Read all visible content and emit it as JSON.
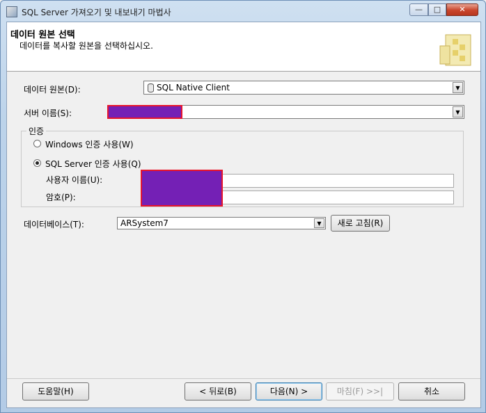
{
  "window": {
    "title": "SQL Server 가져오기 및 내보내기 마법사",
    "controls": {
      "minimize": "—",
      "maximize": "□",
      "close": "✕"
    }
  },
  "header": {
    "title": "데이터 원본 선택",
    "subtitle": "데이터를 복사할 원본을 선택하십시오."
  },
  "form": {
    "datasource_label": "데이터 원본(D):",
    "datasource_value": "SQL Native Client",
    "server_label": "서버 이름(S):",
    "server_value": "",
    "auth_group_title": "인증",
    "windows_auth_label": "Windows 인증 사용(W)",
    "sql_auth_label": "SQL Server 인증 사용(Q)",
    "selected_auth": "sql",
    "username_label": "사용자 이름(U):",
    "password_label": "암호(P):",
    "database_label": "데이터베이스(T):",
    "database_value": "ARSystem7",
    "refresh_button": "새로 고침(R)"
  },
  "footer": {
    "help_button": "도움말(H)",
    "back_button": "< 뒤로(B)",
    "next_button": "다음(N) >",
    "finish_button": "마침(F) >>|",
    "cancel_button": "취소"
  },
  "colors": {
    "redaction_fill": "#7420b5",
    "redaction_border": "#e8142a"
  }
}
